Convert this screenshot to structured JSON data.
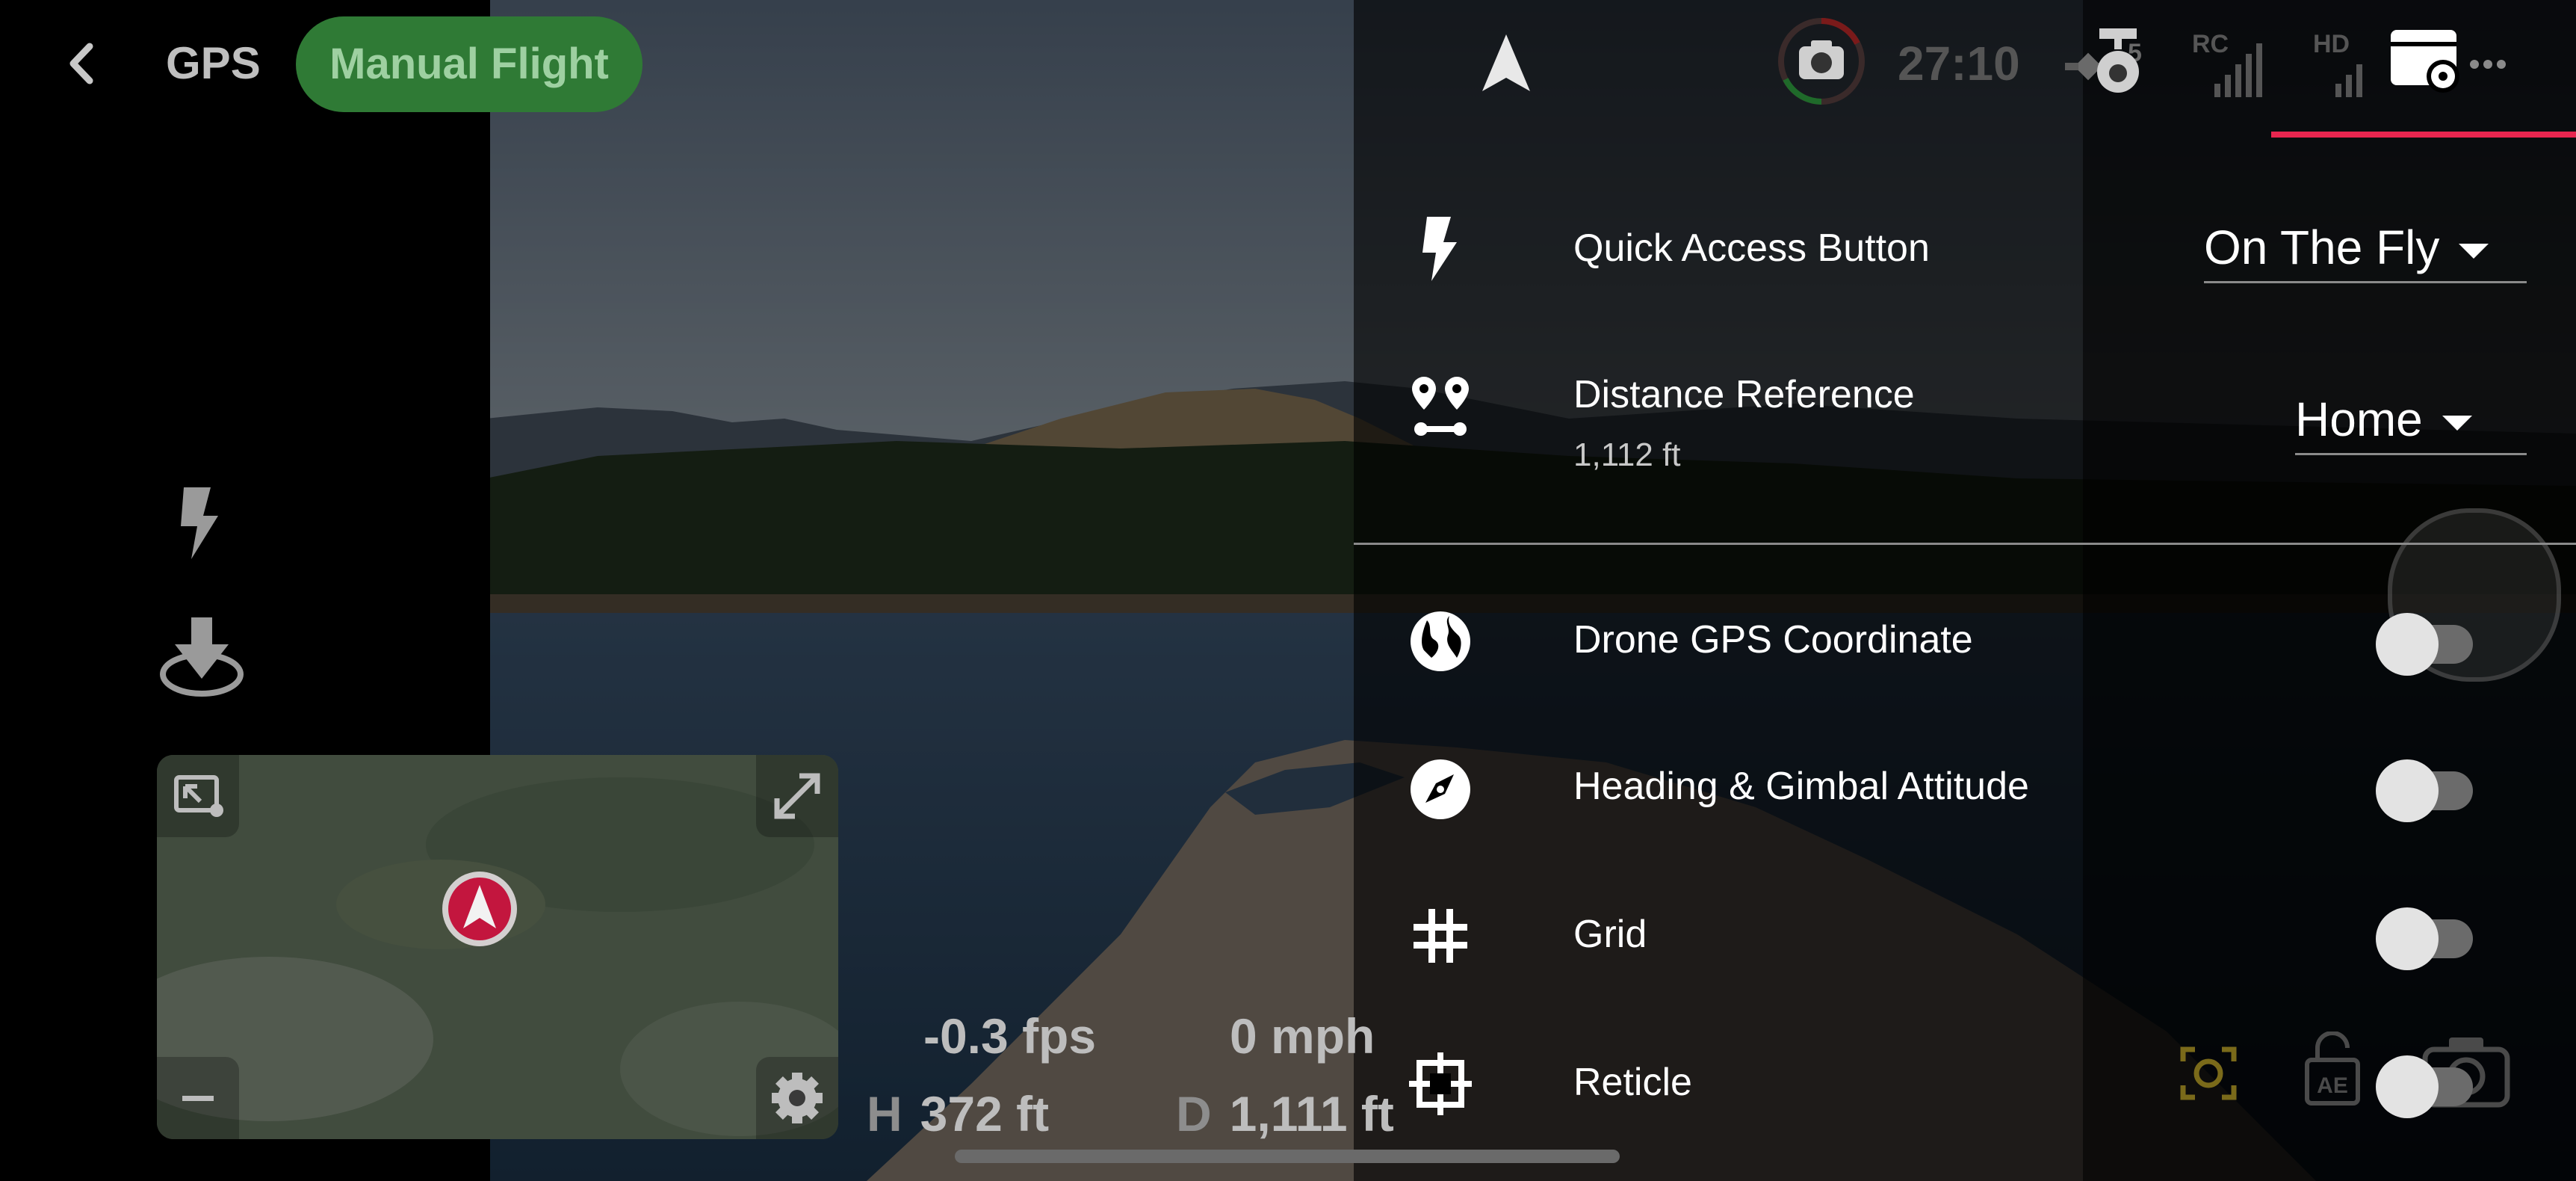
{
  "status_bar": {
    "back_icon": "chevron-left-icon",
    "signal_source": "GPS",
    "flight_mode": "Manual Flight",
    "remaining_time": "27:10",
    "satellite_count": "5",
    "rc_label": "RC",
    "hd_label": "HD",
    "more_icon": "more-dots-icon"
  },
  "left_tools": {
    "quick_icon": "lightning-icon",
    "landing_icon": "landing-icon"
  },
  "minimap": {
    "exit_icon": "minimize-map-icon",
    "expand_icon": "expand-icon",
    "zoom_out_icon": "minus-icon",
    "settings_icon": "gear-icon"
  },
  "telemetry": {
    "vertical_speed": "-0.3 fps",
    "horizontal_speed": "0 mph",
    "height_prefix": "H",
    "height": "372 ft",
    "distance_prefix": "D",
    "distance": "1,111 ft"
  },
  "settings": {
    "quick_access": {
      "label": "Quick Access Button",
      "value": "On The Fly"
    },
    "distance_reference": {
      "label": "Distance Reference",
      "sub": "1,112 ft",
      "value": "Home"
    },
    "drone_gps": {
      "label": "Drone GPS Coordinate",
      "enabled": false
    },
    "heading_gimbal": {
      "label": "Heading & Gimbal Attitude",
      "enabled": false
    },
    "grid": {
      "label": "Grid",
      "enabled": false
    },
    "reticle": {
      "label": "Reticle",
      "enabled": false
    }
  },
  "colors": {
    "accent_pink": "#e8264f",
    "manual_flight_green": "#2f7a35",
    "capture_yellow": "#c9a21a"
  }
}
